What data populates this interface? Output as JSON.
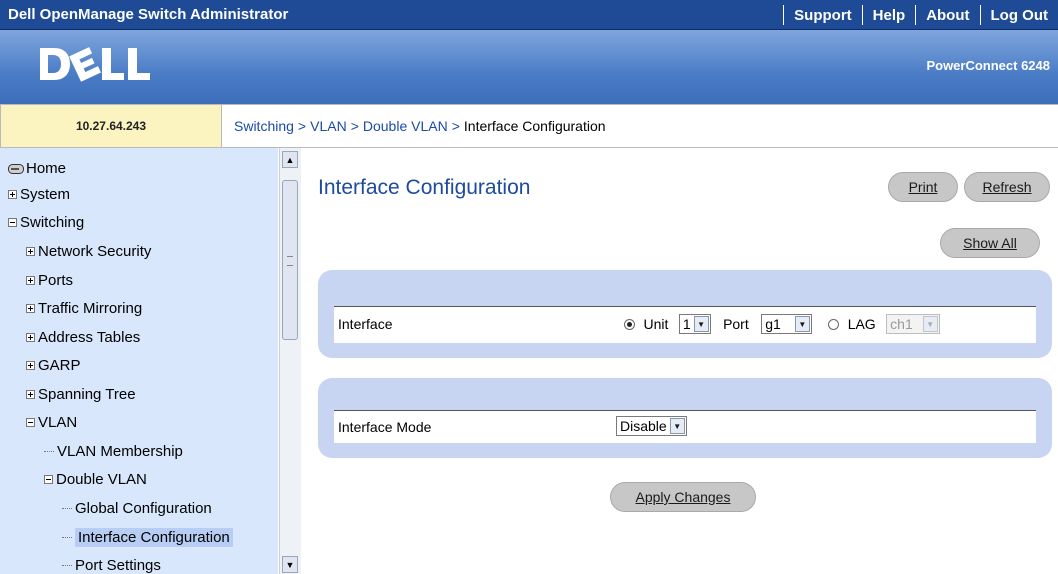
{
  "topbar": {
    "title": "Dell OpenManage Switch Administrator",
    "links": [
      "Support",
      "Help",
      "About",
      "Log Out"
    ]
  },
  "brand": {
    "logo_text": "DELL",
    "model": "PowerConnect 6248"
  },
  "device": {
    "ip": "10.27.64.243"
  },
  "breadcrumb": {
    "items": [
      "Switching",
      "VLAN",
      "Double VLAN"
    ],
    "separator": ">",
    "current": "Interface Configuration"
  },
  "sidebar": {
    "items": [
      {
        "label": "Home",
        "icon": "drive-icon"
      },
      {
        "label": "System",
        "icon": "expand-icon"
      },
      {
        "label": "Switching",
        "icon": "collapse-icon"
      },
      {
        "label": "Network Security",
        "icon": "expand-icon"
      },
      {
        "label": "Ports",
        "icon": "expand-icon"
      },
      {
        "label": "Traffic Mirroring",
        "icon": "expand-icon"
      },
      {
        "label": "Address Tables",
        "icon": "expand-icon"
      },
      {
        "label": "GARP",
        "icon": "expand-icon"
      },
      {
        "label": "Spanning Tree",
        "icon": "expand-icon"
      },
      {
        "label": "VLAN",
        "icon": "collapse-icon"
      },
      {
        "label": "VLAN Membership",
        "icon": "tree-line"
      },
      {
        "label": "Double VLAN",
        "icon": "collapse-icon"
      },
      {
        "label": "Global Configuration",
        "icon": "tree-line"
      },
      {
        "label": "Interface Configuration",
        "icon": "tree-line",
        "selected": true
      },
      {
        "label": "Port Settings",
        "icon": "tree-line"
      }
    ]
  },
  "main": {
    "title": "Interface Configuration",
    "buttons": {
      "print": "Print",
      "refresh": "Refresh",
      "show_all": "Show All",
      "apply": "Apply Changes"
    },
    "interface": {
      "label": "Interface",
      "unit_label": "Unit",
      "unit_value": "1",
      "port_label": "Port",
      "port_value": "g1",
      "lag_label": "LAG",
      "lag_value": "ch1",
      "selected_option": "Unit"
    },
    "interface_mode": {
      "label": "Interface Mode",
      "value": "Disable"
    }
  },
  "colors": {
    "topbar": "#1e4a96",
    "sidebar": "#d8e7fb",
    "panel": "#c7d4f2",
    "title": "#1e4aa0",
    "ip_box": "#fbf3c0"
  }
}
